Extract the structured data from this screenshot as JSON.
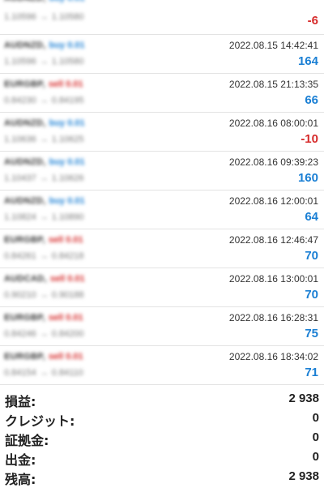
{
  "trades": [
    {
      "symbol": "AUDNZD,",
      "side": "buy 0.01",
      "side_type": "buy",
      "open_price": "1.10596",
      "close_price": "1.10580",
      "time": "",
      "profit": "-6",
      "profit_sign": "neg"
    },
    {
      "symbol": "AUDNZD,",
      "side": "buy 0.01",
      "side_type": "buy",
      "open_price": "1.10596",
      "close_price": "1.10580",
      "time": "2022.08.15 14:42:41",
      "profit": "164",
      "profit_sign": "pos"
    },
    {
      "symbol": "EURGBP,",
      "side": "sell 0.01",
      "side_type": "sell",
      "open_price": "0.84230",
      "close_price": "0.84195",
      "time": "2022.08.15 21:13:35",
      "profit": "66",
      "profit_sign": "pos"
    },
    {
      "symbol": "AUDNZD,",
      "side": "buy 0.01",
      "side_type": "buy",
      "open_price": "1.10636",
      "close_price": "1.10625",
      "time": "2022.08.16 08:00:01",
      "profit": "-10",
      "profit_sign": "neg"
    },
    {
      "symbol": "AUDNZD,",
      "side": "buy 0.01",
      "side_type": "buy",
      "open_price": "1.10437",
      "close_price": "1.10626",
      "time": "2022.08.16 09:39:23",
      "profit": "160",
      "profit_sign": "pos"
    },
    {
      "symbol": "AUDNZD,",
      "side": "buy 0.01",
      "side_type": "buy",
      "open_price": "1.10824",
      "close_price": "1.10890",
      "time": "2022.08.16 12:00:01",
      "profit": "64",
      "profit_sign": "pos"
    },
    {
      "symbol": "EURGBP,",
      "side": "sell 0.01",
      "side_type": "sell",
      "open_price": "0.84261",
      "close_price": "0.84218",
      "time": "2022.08.16 12:46:47",
      "profit": "70",
      "profit_sign": "pos"
    },
    {
      "symbol": "AUDCAD,",
      "side": "sell 0.01",
      "side_type": "sell",
      "open_price": "0.90210",
      "close_price": "0.90188",
      "time": "2022.08.16 13:00:01",
      "profit": "70",
      "profit_sign": "pos"
    },
    {
      "symbol": "EURGBP,",
      "side": "sell 0.01",
      "side_type": "sell",
      "open_price": "0.84246",
      "close_price": "0.84200",
      "time": "2022.08.16 16:28:31",
      "profit": "75",
      "profit_sign": "pos"
    },
    {
      "symbol": "EURGBP,",
      "side": "sell 0.01",
      "side_type": "sell",
      "open_price": "0.84154",
      "close_price": "0.84110",
      "time": "2022.08.16 18:34:02",
      "profit": "71",
      "profit_sign": "pos"
    }
  ],
  "summary": [
    {
      "label": "損益:",
      "value": "2 938"
    },
    {
      "label": "クレジット:",
      "value": "0"
    },
    {
      "label": "証拠金:",
      "value": "0"
    },
    {
      "label": "出金:",
      "value": "0"
    },
    {
      "label": "残高:",
      "value": "2 938"
    }
  ],
  "colors": {
    "positive": "#1a7fd4",
    "negative": "#d62a2a",
    "buy": "#1a7fd4",
    "sell": "#d62a2a"
  }
}
